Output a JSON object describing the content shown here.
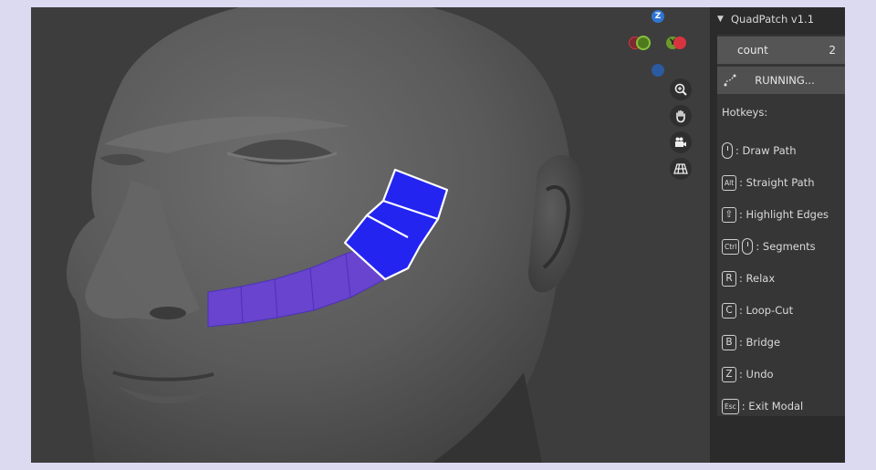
{
  "gizmo": {
    "z_label": "Z",
    "y_label": "Y",
    "colors": {
      "x": "#d8343f",
      "y": "#6a9b2b",
      "z": "#2e76d2"
    }
  },
  "viewport_nav": [
    {
      "name": "zoom-icon"
    },
    {
      "name": "hand-pan-icon"
    },
    {
      "name": "camera-icon"
    },
    {
      "name": "grid-icon"
    }
  ],
  "panel": {
    "title": "QuadPatch v1.1",
    "count_label": "count",
    "count_value": "2",
    "running_label": "RUNNING...",
    "hotkeys_title": "Hotkeys:",
    "hotkeys": [
      {
        "key": "",
        "icon": "mouse-left-icon",
        "label": ": Draw Path"
      },
      {
        "key": "Alt",
        "label": ": Straight Path"
      },
      {
        "key": "⇧",
        "label": ": Highlight Edges"
      },
      {
        "key": "Ctrl",
        "icon": "mouse-wheel-icon",
        "label": ": Segments"
      },
      {
        "key": "R",
        "label": ": Relax"
      },
      {
        "key": "C",
        "label": ": Loop-Cut"
      },
      {
        "key": "B",
        "label": ": Bridge"
      },
      {
        "key": "Z",
        "label": ": Undo"
      },
      {
        "key": "Esc",
        "label": ": Exit Modal"
      }
    ]
  },
  "colors": {
    "patch_selected": "#2424f0",
    "patch_unselected": "#6a42d8",
    "background": "#3d3d3d"
  }
}
